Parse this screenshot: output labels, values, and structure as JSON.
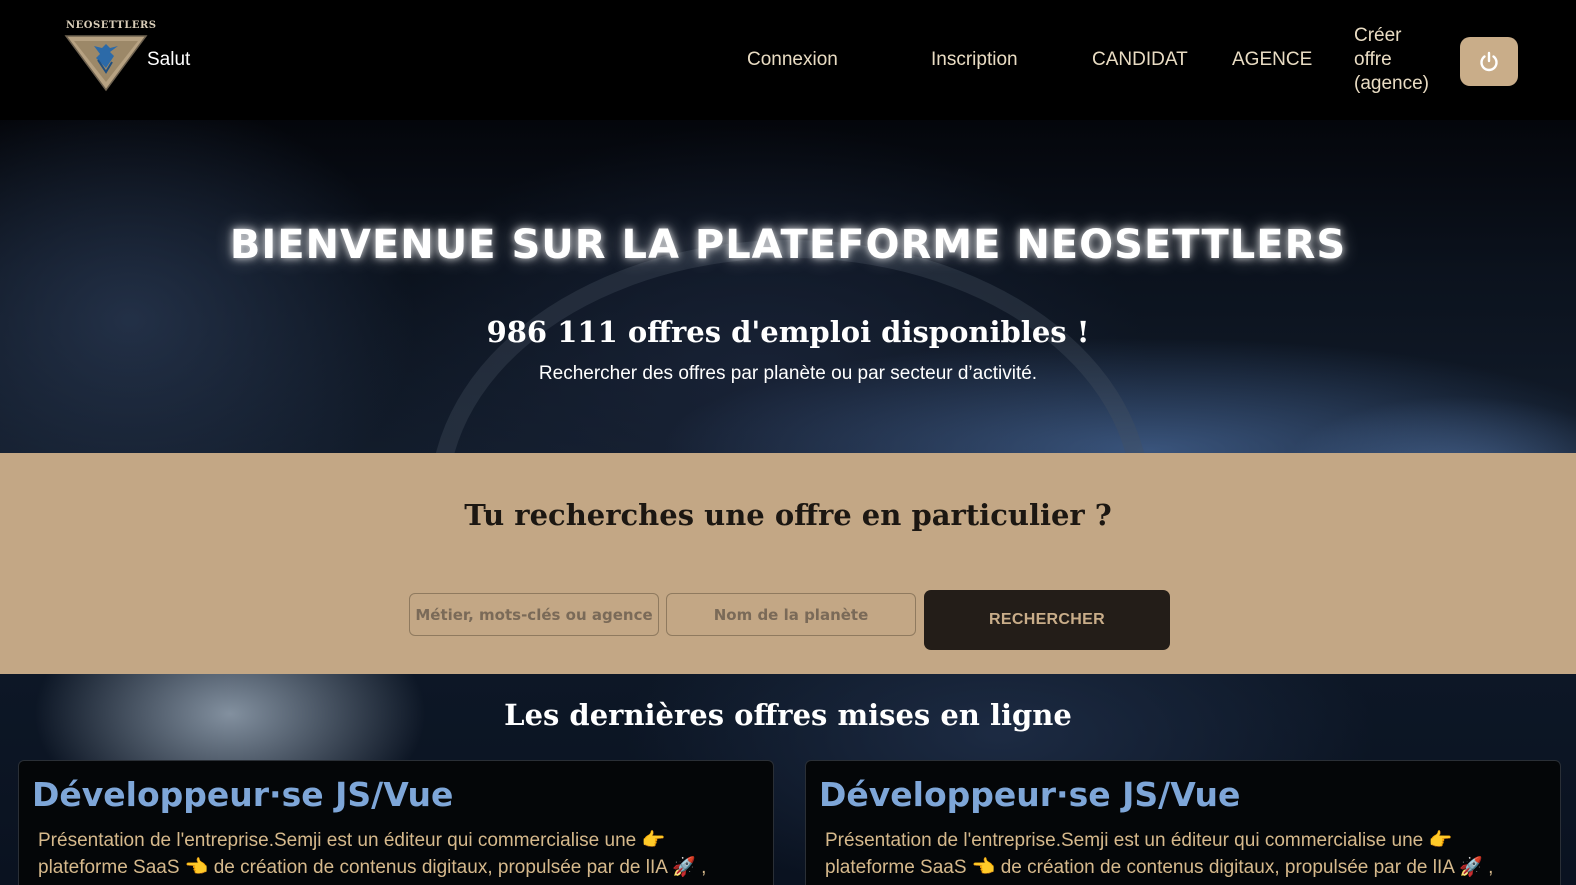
{
  "header": {
    "logo_text": "NEOSETTLERS",
    "greeting": "Salut",
    "nav": {
      "login": "Connexion",
      "signup": "Inscription",
      "candidate": "CANDIDAT",
      "agency": "AGENCE",
      "create_offer": "Créer offre (agence)"
    },
    "power_icon": "power-icon"
  },
  "hero": {
    "title": "BIENVENUE SUR LA PLATEFORME NEOSETTLERS",
    "count_text": "986 111 offres d'emploi disponibles !",
    "subtitle": "Rechercher des offres par planète ou par secteur d’activité."
  },
  "search": {
    "title": "Tu recherches une offre en particulier ?",
    "keyword_placeholder": "Métier, mots-clés ou agence",
    "planet_placeholder": "Nom de la planète",
    "button_label": "RECHERCHER"
  },
  "latest": {
    "title": "Les dernières offres mises en ligne",
    "cards": [
      {
        "title": "Développeur·se JS/Vue",
        "description": "Présentation de l'entreprise.Semji est un éditeur qui commercialise une 👉 plateforme SaaS 👈 de création de contenus digitaux, propulsée par de lIA 🚀 , accompagnée de"
      },
      {
        "title": "Développeur·se JS/Vue",
        "description": "Présentation de l'entreprise.Semji est un éditeur qui commercialise une 👉 plateforme SaaS 👈 de création de contenus digitaux, propulsée par de lIA 🚀 , accompagnée de"
      }
    ]
  },
  "colors": {
    "accent": "#c3a785",
    "button_dark": "#231d18",
    "card_title": "#7ea6d8",
    "card_text": "#d6b98c"
  }
}
